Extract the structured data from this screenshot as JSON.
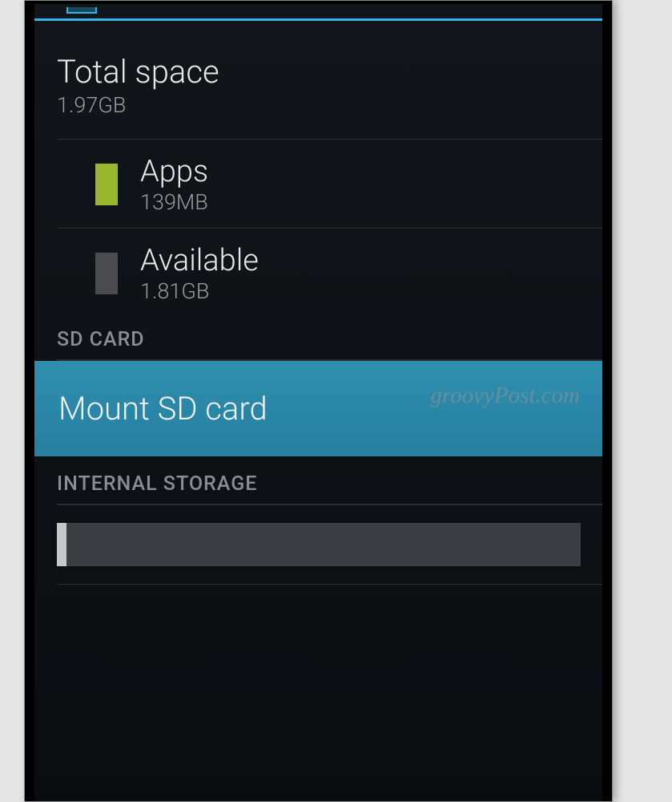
{
  "storage": {
    "total": {
      "label": "Total space",
      "value": "1.97GB"
    },
    "items": [
      {
        "label": "Apps",
        "value": "139MB",
        "swatch": "apps"
      },
      {
        "label": "Available",
        "value": "1.81GB",
        "swatch": "available"
      }
    ]
  },
  "sections": {
    "sdcard": "SD CARD",
    "internal": "INTERNAL STORAGE"
  },
  "actions": {
    "mount": "Mount SD card"
  },
  "watermark": "groovyPost.com"
}
